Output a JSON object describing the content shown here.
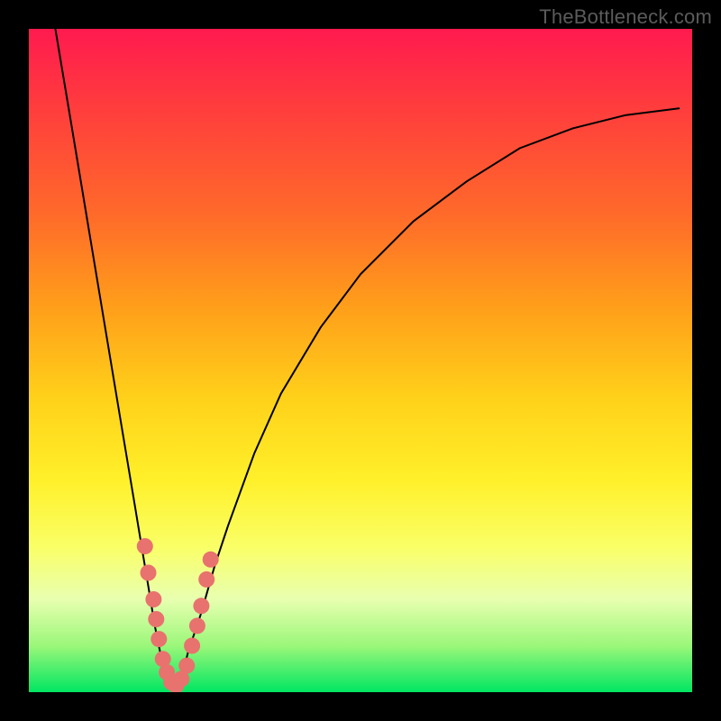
{
  "watermark": "TheBottleneck.com",
  "colors": {
    "frame": "#000000",
    "gradient_top": "#ff1a4f",
    "gradient_bottom": "#00e662",
    "curve": "#000000",
    "knots": "#e8726e"
  },
  "chart_data": {
    "type": "line",
    "title": "",
    "xlabel": "",
    "ylabel": "",
    "xlim": [
      0,
      100
    ],
    "ylim": [
      0,
      100
    ],
    "series": [
      {
        "name": "bottleneck-curve",
        "x": [
          4,
          6,
          8,
          10,
          12,
          14,
          16,
          17,
          18,
          19,
          20,
          21,
          22,
          23,
          24,
          26,
          28,
          30,
          34,
          38,
          44,
          50,
          58,
          66,
          74,
          82,
          90,
          98
        ],
        "y": [
          100,
          88,
          76,
          64,
          52,
          40,
          28,
          22,
          16,
          10,
          5,
          2,
          0,
          2,
          6,
          12,
          19,
          25,
          36,
          45,
          55,
          63,
          71,
          77,
          82,
          85,
          87,
          88
        ]
      }
    ],
    "knots": {
      "name": "data-points",
      "x": [
        17.5,
        18.0,
        18.8,
        19.2,
        19.6,
        20.2,
        20.8,
        21.5,
        22.2,
        23.0,
        23.8,
        24.6,
        25.4,
        26.0,
        26.8,
        27.4
      ],
      "y": [
        22,
        18,
        14,
        11,
        8,
        5,
        3,
        1.5,
        1,
        2,
        4,
        7,
        10,
        13,
        17,
        20
      ]
    }
  }
}
